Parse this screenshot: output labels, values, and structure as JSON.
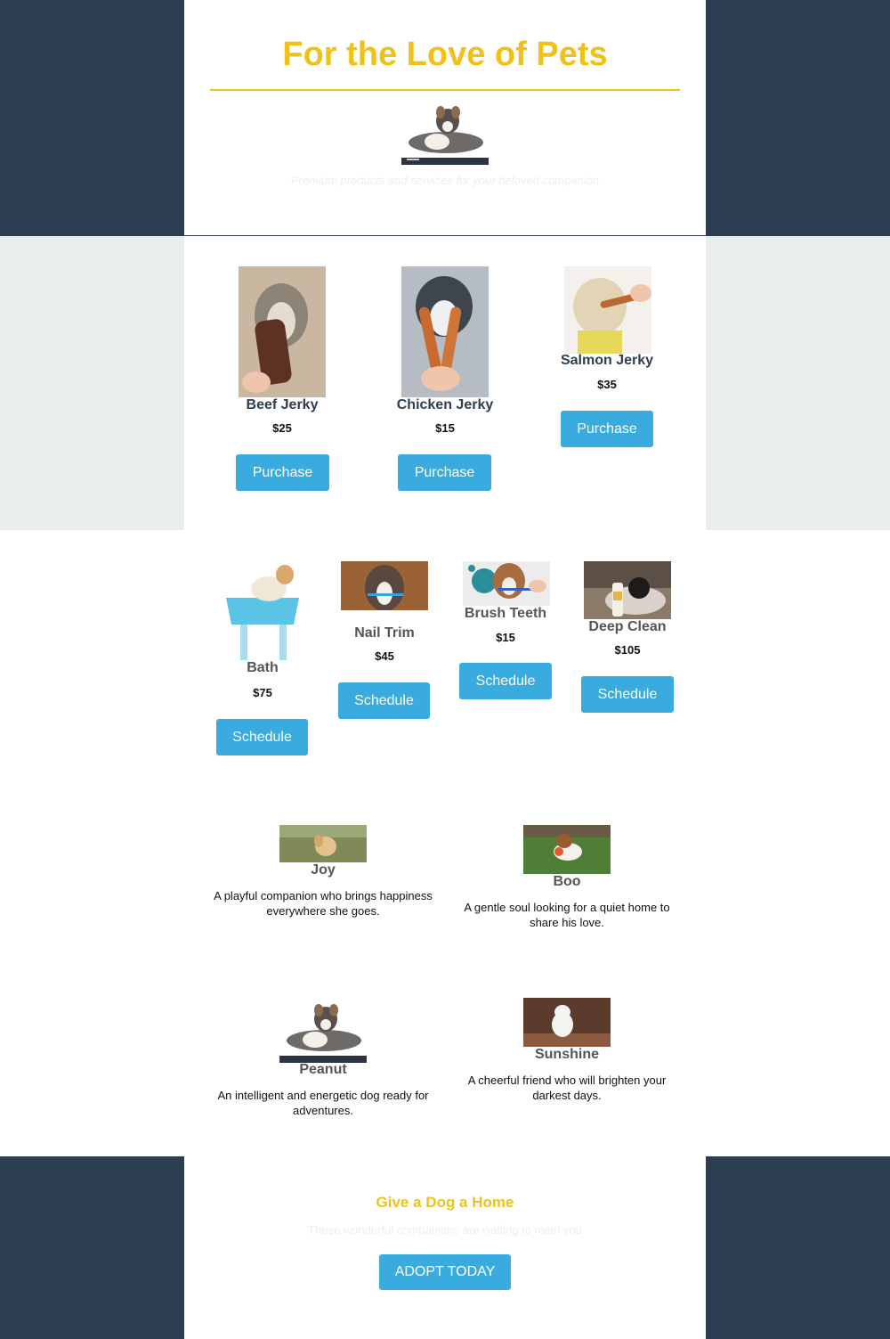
{
  "colors": {
    "navy": "#2d3e50",
    "gold": "#f0c11a",
    "blue": "#3aabde",
    "grey_band": "#e9eded",
    "faint_text": "#eeeeee"
  },
  "header": {
    "title": "For the Love of Pets",
    "subtitle": "Premium products and services for your beloved companion",
    "hero_image": "australian-shepherd-photo"
  },
  "products": [
    {
      "name": "Beef Jerky",
      "price": "$25",
      "button": "Purchase",
      "image": "husky-beef-jerky-photo"
    },
    {
      "name": "Chicken Jerky",
      "price": "$15",
      "button": "Purchase",
      "image": "husky-chicken-jerky-photo"
    },
    {
      "name": "Salmon Jerky",
      "price": "$35",
      "button": "Purchase",
      "image": "poodle-salmon-jerky-photo"
    }
  ],
  "services": [
    {
      "name": "Bath",
      "price": "$75",
      "button": "Schedule",
      "image": "dog-bath-tub-photo"
    },
    {
      "name": "Nail Trim",
      "price": "$45",
      "button": "Schedule",
      "image": "aussie-toothbrush-photo"
    },
    {
      "name": "Brush Teeth",
      "price": "$15",
      "button": "Schedule",
      "image": "puppy-toothbrush-photo"
    },
    {
      "name": "Deep Clean",
      "price": "$105",
      "button": "Schedule",
      "image": "dog-bed-cleaner-photo"
    }
  ],
  "dogs": [
    {
      "name": "Joy",
      "description": "A playful companion who brings happiness everywhere she goes.",
      "image": "golden-puppy-photo"
    },
    {
      "name": "Boo",
      "description": "A gentle soul looking for a quiet home to share his love.",
      "image": "beagle-ball-photo"
    },
    {
      "name": "Peanut",
      "description": "An intelligent and energetic dog ready for adventures.",
      "image": "australian-shepherd-photo"
    },
    {
      "name": "Sunshine",
      "description": "A cheerful friend who will brighten your darkest days.",
      "image": "white-terrier-photo"
    }
  ],
  "footer": {
    "title": "Give a Dog a Home",
    "subtitle": "These wonderful companions are waiting to meet you",
    "button": "ADOPT TODAY"
  }
}
